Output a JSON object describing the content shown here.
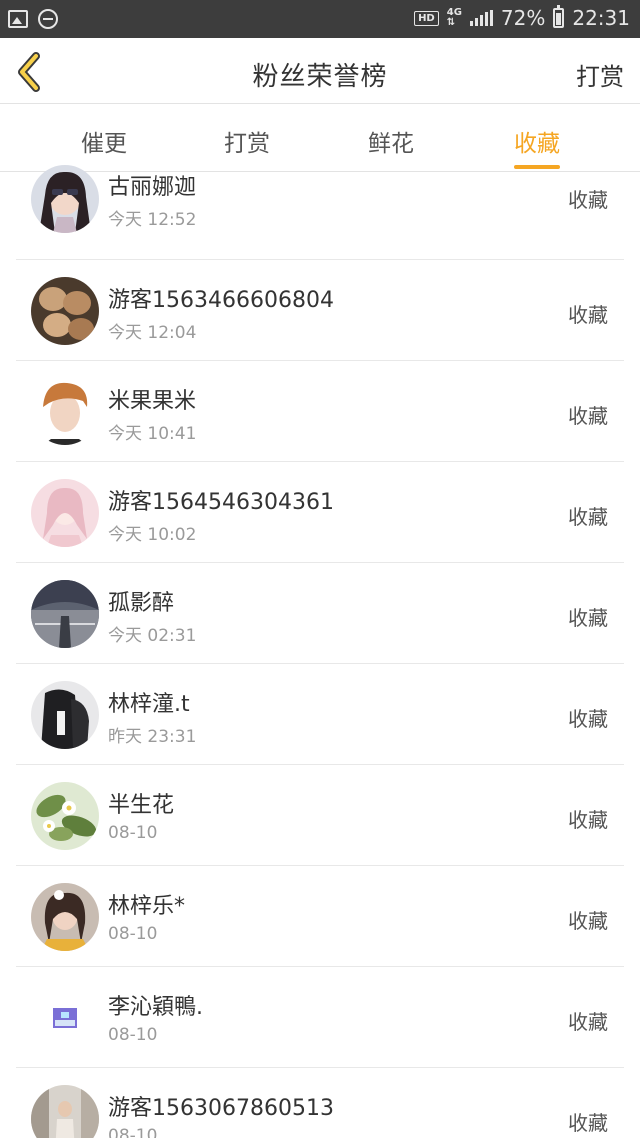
{
  "status_bar": {
    "hd": "HD",
    "network": "4G",
    "battery": "72%",
    "time": "22:31"
  },
  "nav": {
    "title": "粉丝荣誉榜",
    "right_action": "打赏"
  },
  "tabs": [
    {
      "label": "催更",
      "active": false
    },
    {
      "label": "打赏",
      "active": false
    },
    {
      "label": "鲜花",
      "active": false
    },
    {
      "label": "收藏",
      "active": true
    }
  ],
  "colors": {
    "accent": "#f5a623",
    "status_bar": "#3d3d3d"
  },
  "fans": [
    {
      "name": "古丽娜迦",
      "time": "今天 12:52",
      "action": "收藏",
      "avatar": "avatar-girl-sunglasses"
    },
    {
      "name": "游客1563466606804",
      "time": "今天 12:04",
      "action": "收藏",
      "avatar": "avatar-eggs"
    },
    {
      "name": "米果果米",
      "time": "今天 10:41",
      "action": "收藏",
      "avatar": "avatar-boy"
    },
    {
      "name": "游客1564546304361",
      "time": "今天 10:02",
      "action": "收藏",
      "avatar": "avatar-pink-anime"
    },
    {
      "name": "孤影醉",
      "time": "今天 02:31",
      "action": "收藏",
      "avatar": "avatar-tunnel"
    },
    {
      "name": "林梓潼.t",
      "time": "昨天 23:31",
      "action": "收藏",
      "avatar": "avatar-dark-figure"
    },
    {
      "name": "半生花",
      "time": "08-10",
      "action": "收藏",
      "avatar": "avatar-flowers"
    },
    {
      "name": "林梓乐*",
      "time": "08-10",
      "action": "收藏",
      "avatar": "avatar-girl-yellow"
    },
    {
      "name": "李沁穎鴨.",
      "time": "08-10",
      "action": "收藏",
      "avatar": "avatar-small-square"
    },
    {
      "name": "游客1563067860513",
      "time": "08-10",
      "action": "收藏",
      "avatar": "avatar-street"
    }
  ]
}
